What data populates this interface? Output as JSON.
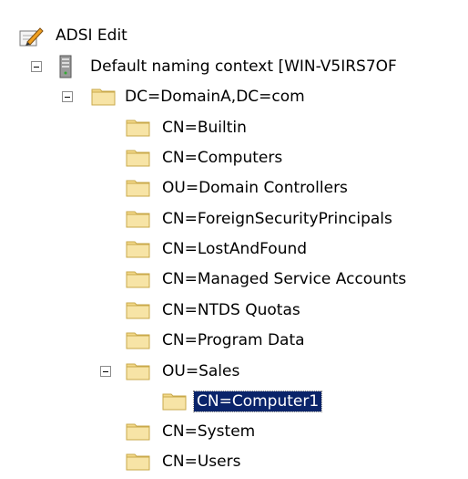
{
  "root": {
    "label": "ADSI Edit",
    "icon": "adsi-edit-icon"
  },
  "context": {
    "label": "Default naming context [WIN-V5IRS7OF",
    "icon": "server-icon"
  },
  "domain": {
    "label": "DC=DomainA,DC=com",
    "icon": "folder-icon"
  },
  "children": [
    {
      "label": "CN=Builtin"
    },
    {
      "label": "CN=Computers"
    },
    {
      "label": "OU=Domain Controllers"
    },
    {
      "label": "CN=ForeignSecurityPrincipals"
    },
    {
      "label": "CN=LostAndFound"
    },
    {
      "label": "CN=Managed Service Accounts"
    },
    {
      "label": "CN=NTDS Quotas"
    },
    {
      "label": "CN=Program Data"
    },
    {
      "label": "OU=Sales"
    },
    {
      "label": "CN=Computer1",
      "selected": true
    },
    {
      "label": "CN=System"
    },
    {
      "label": "CN=Users"
    }
  ],
  "colors": {
    "folder": "#f3d98a",
    "folder_edge": "#c9a94a",
    "selection": "#0a246a"
  }
}
